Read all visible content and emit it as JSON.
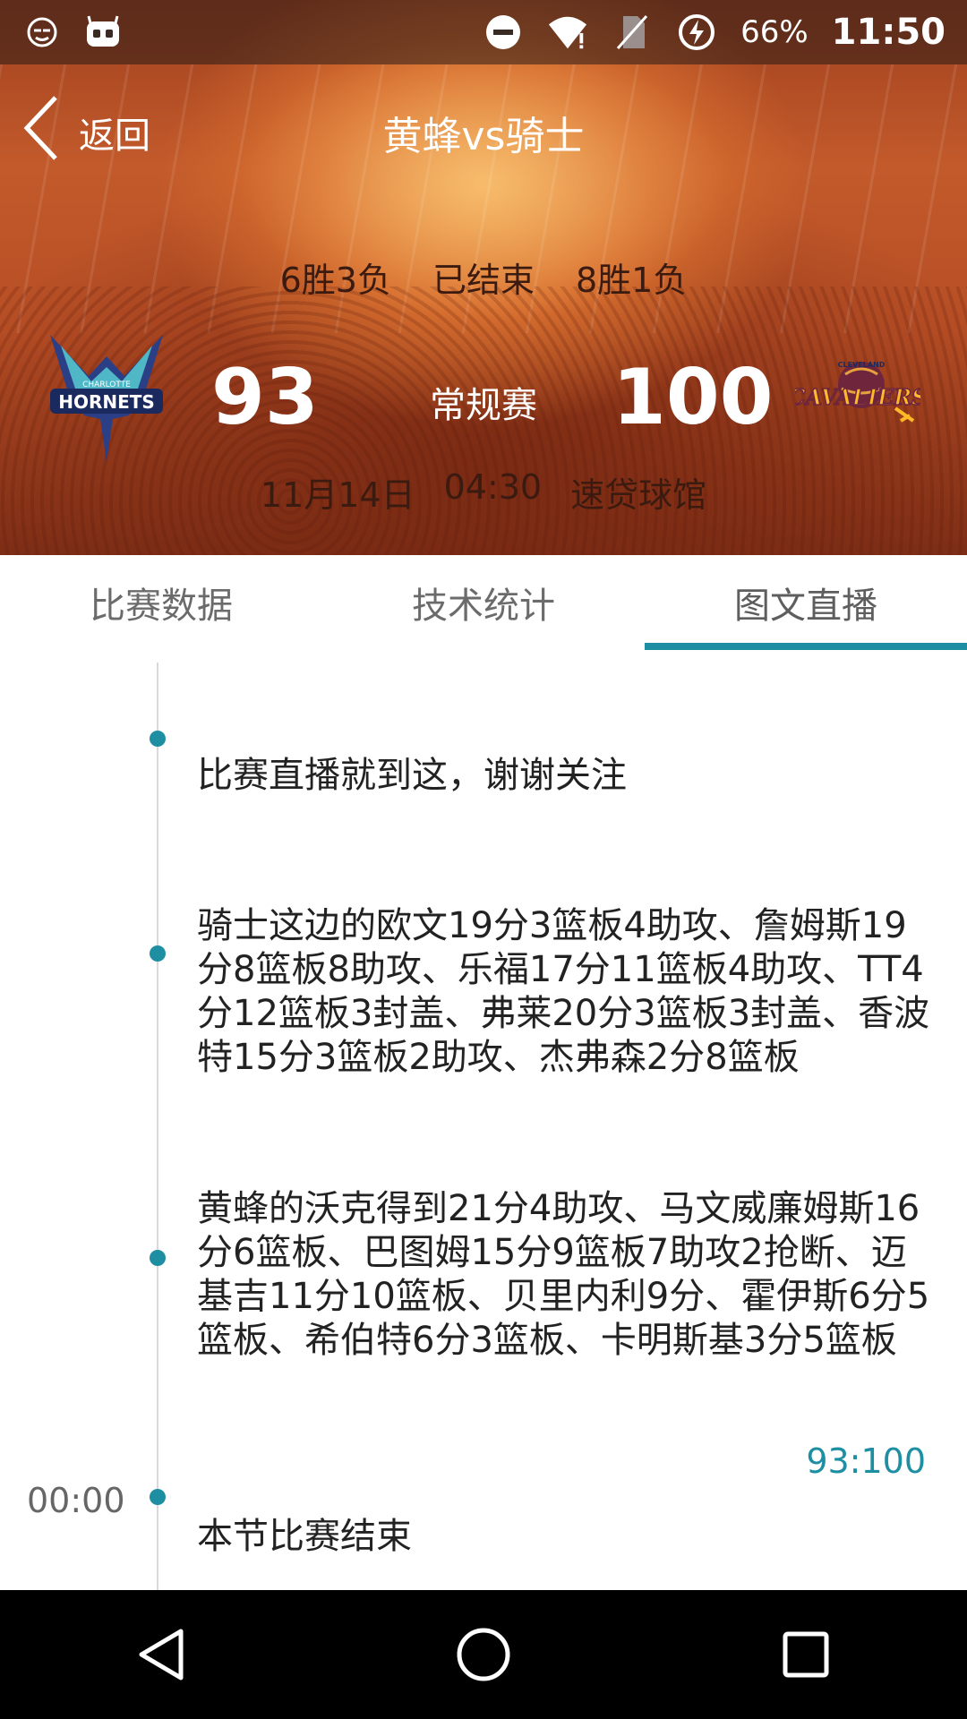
{
  "status_bar": {
    "battery": "66%",
    "time": "11:50",
    "icons": [
      "face-icon",
      "robot-icon",
      "dnd-icon",
      "wifi-icon",
      "no-sim-icon",
      "battery-icon"
    ]
  },
  "nav": {
    "back_label": "返回",
    "title": "黄蜂vs骑士"
  },
  "game": {
    "home_record": "6胜3负",
    "status": "已结束",
    "away_record": "8胜1负",
    "home_score": "93",
    "away_score": "100",
    "type": "常规赛",
    "date": "11月14日",
    "time": "04:30",
    "venue": "速贷球馆",
    "home_logo_text": "HORNETS",
    "home_logo_subtext": "CHARLOTTE",
    "away_logo_text": "CAVALIERS",
    "away_logo_subtext": "CLEVELAND"
  },
  "tabs": [
    {
      "label": "比赛数据"
    },
    {
      "label": "技术统计"
    },
    {
      "label": "图文直播"
    }
  ],
  "feed": [
    {
      "time": "",
      "score": "",
      "text": "比赛直播就到这，谢谢关注"
    },
    {
      "time": "",
      "score": "",
      "text": "骑士这边的欧文19分3篮板4助攻、詹姆斯19分8篮板8助攻、乐福17分11篮板4助攻、TT4分12篮板3封盖、弗莱20分3篮板3封盖、香波特15分3篮板2助攻、杰弗森2分8篮板"
    },
    {
      "time": "",
      "score": "",
      "text": "黄蜂的沃克得到21分4助攻、马文威廉姆斯16分6篮板、巴图姆15分9篮板7助攻2抢断、迈基吉11分10篮板、贝里内利9分、霍伊斯6分5篮板、希伯特6分3篮板、卡明斯基3分5篮板"
    },
    {
      "time": "00:00",
      "score": "93:100",
      "text": "本节比赛结束"
    }
  ],
  "colors": {
    "accent": "#1e8fa3",
    "header_orange": "#c25a2b"
  }
}
